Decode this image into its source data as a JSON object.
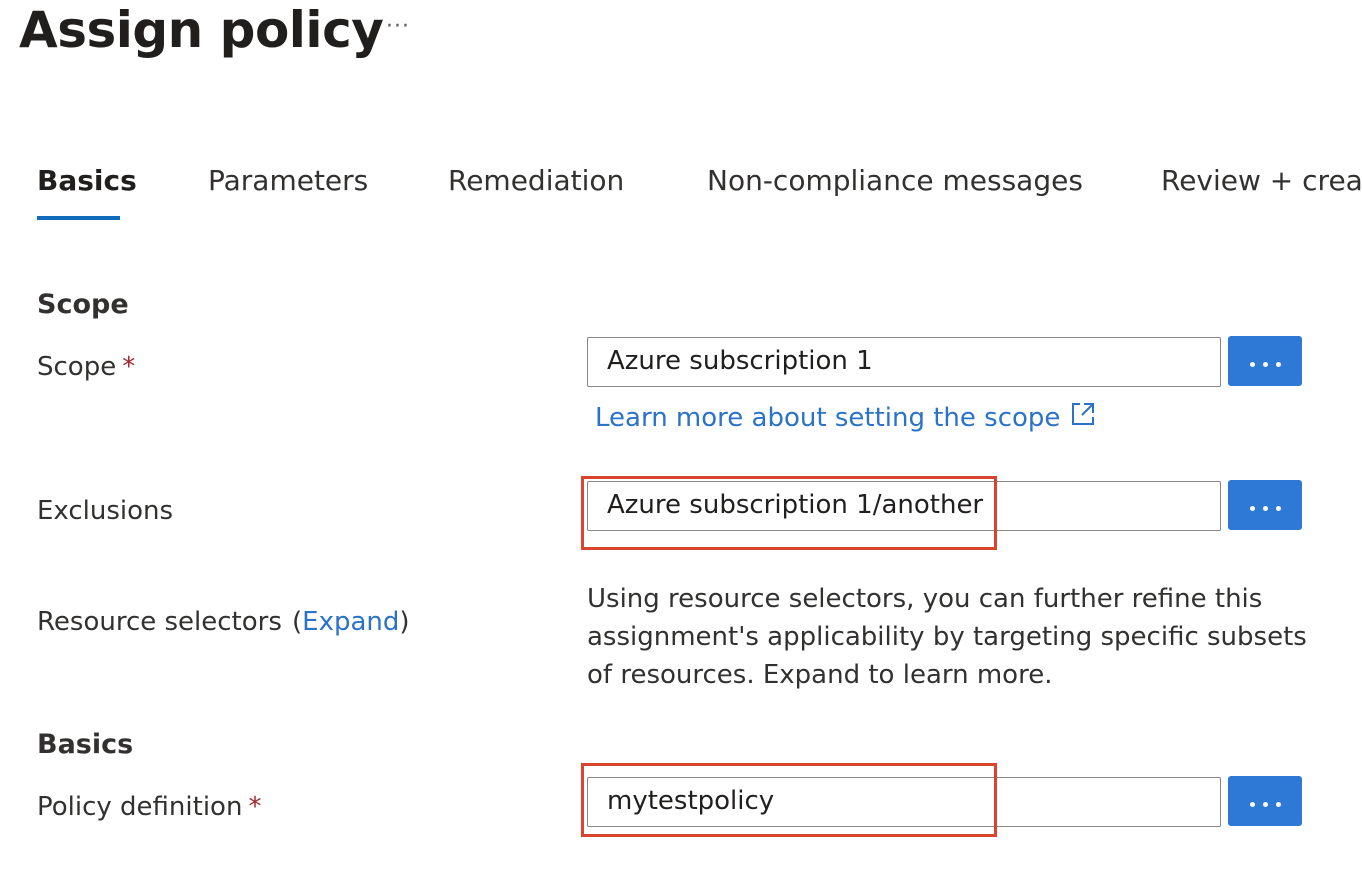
{
  "header": {
    "title": "Assign policy",
    "more_label": "···"
  },
  "tabs": [
    {
      "label": "Basics",
      "active": true
    },
    {
      "label": "Parameters",
      "active": false
    },
    {
      "label": "Remediation",
      "active": false
    },
    {
      "label": "Non-compliance messages",
      "active": false
    },
    {
      "label": "Review + create",
      "active": false
    }
  ],
  "scope_section": {
    "heading": "Scope",
    "scope_label": "Scope",
    "required_mark": "*",
    "scope_value": "Azure subscription 1",
    "learn_more_link": "Learn more about setting the scope",
    "exclusions_label": "Exclusions",
    "exclusions_value": "Azure subscription 1/another",
    "resource_selectors_label": "Resource selectors",
    "expand_open": "(",
    "expand_link": "Expand",
    "expand_close": ")",
    "resource_selectors_description": "Using resource selectors, you can further refine this assignment's applicability by targeting specific subsets of resources. Expand to learn more."
  },
  "basics_section": {
    "heading": "Basics",
    "policy_definition_label": "Policy definition",
    "required_mark": "*",
    "policy_definition_value": "mytestpolicy"
  },
  "icons": {
    "browse_button": "more-dots-icon",
    "external_link": "external-link-icon"
  },
  "colors": {
    "accent": "#2f79d6",
    "link": "#2b73c8",
    "tab_underline": "#0f6cbd",
    "required": "#a4262c",
    "highlight": "#d9442f"
  }
}
